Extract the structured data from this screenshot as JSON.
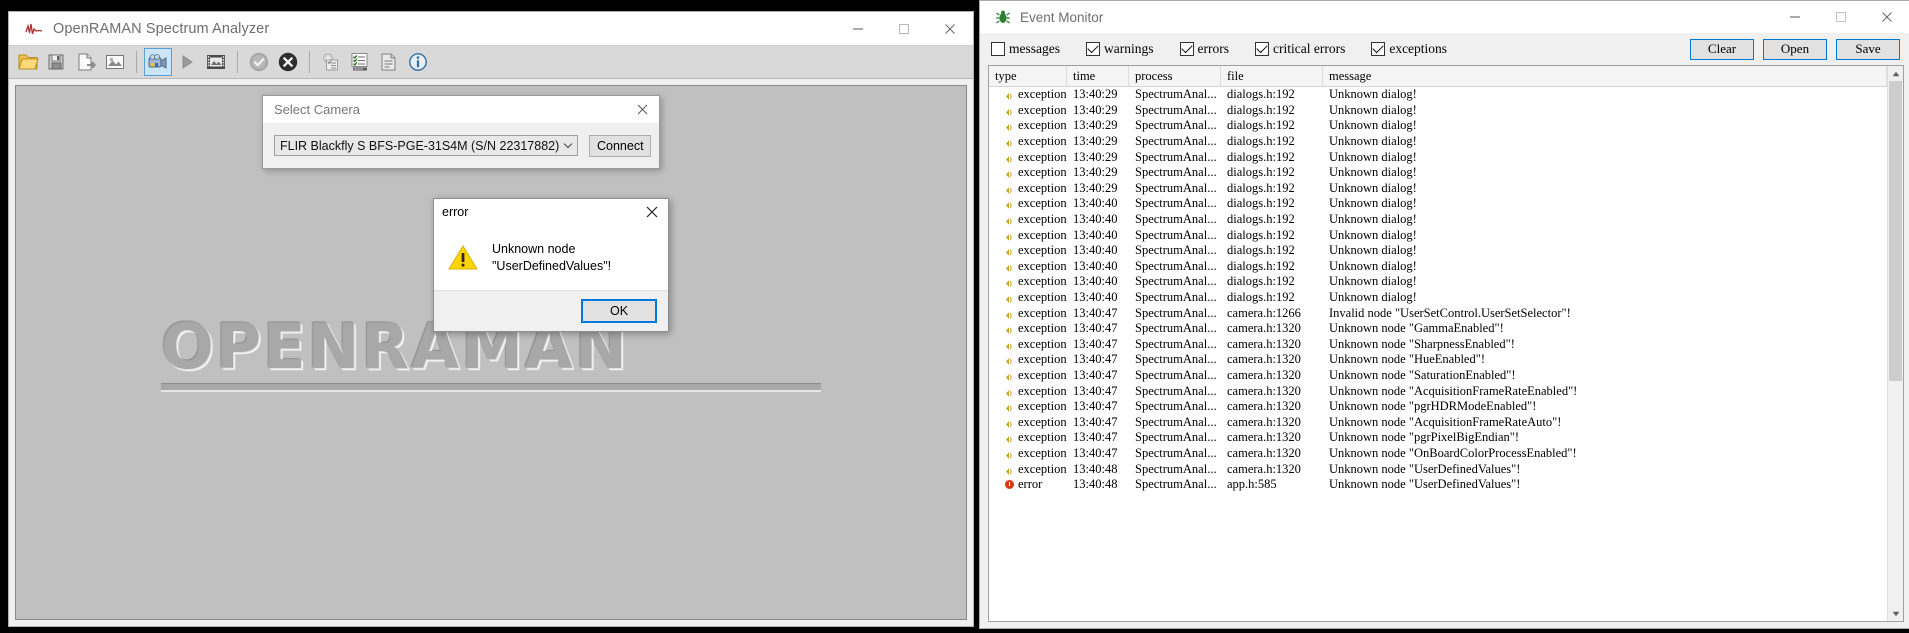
{
  "main_window": {
    "title": "OpenRAMAN Spectrum Analyzer",
    "app_icon": "waveform-icon",
    "controls": {
      "minimize": "minimize-icon",
      "maximize": "maximize-icon",
      "close": "close-icon"
    },
    "toolbar": [
      {
        "name": "open-file-button",
        "icon": "folder-icon",
        "selected": false
      },
      {
        "name": "save-button",
        "icon": "save-disk-icon",
        "selected": false
      },
      {
        "name": "copy-button",
        "icon": "copy-page-icon",
        "selected": false
      },
      {
        "name": "export-image-button",
        "icon": "export-image-icon",
        "selected": false
      },
      {
        "name": "camera-button",
        "icon": "video-camera-icon",
        "selected": true
      },
      {
        "name": "play-button",
        "icon": "play-triangle-icon",
        "selected": false
      },
      {
        "name": "film-button",
        "icon": "film-strip-icon",
        "selected": false
      },
      {
        "name": "accept-button",
        "icon": "check-circle-icon",
        "selected": false
      },
      {
        "name": "cancel-button",
        "icon": "cross-circle-icon",
        "selected": false
      },
      {
        "name": "calibration-button",
        "icon": "clipboard-gear-icon",
        "selected": false
      },
      {
        "name": "checklist-button",
        "icon": "checklist-icon",
        "selected": false
      },
      {
        "name": "properties-button",
        "icon": "properties-icon",
        "selected": false
      },
      {
        "name": "about-button",
        "icon": "info-circle-icon",
        "selected": false
      }
    ],
    "watermark": "OPENRAMAN"
  },
  "select_camera_dialog": {
    "title": "Select Camera",
    "close_icon": "close-icon",
    "camera_value": "FLIR Blackfly S BFS-PGE-31S4M (S/N 22317882)",
    "dropdown_icon": "chevron-down-icon",
    "connect_label": "Connect"
  },
  "error_dialog": {
    "title": "error",
    "close_icon": "close-icon",
    "warning_icon": "warning-triangle-icon",
    "message": "Unknown node \"UserDefinedValues\"!",
    "ok_label": "OK"
  },
  "event_monitor": {
    "title": "Event Monitor",
    "app_icon": "green-bug-icon",
    "controls": {
      "minimize": "minimize-icon",
      "maximize": "maximize-icon",
      "close": "close-icon"
    },
    "filters": [
      {
        "label": "messages",
        "checked": false
      },
      {
        "label": "warnings",
        "checked": true
      },
      {
        "label": "errors",
        "checked": true
      },
      {
        "label": "critical errors",
        "checked": true
      },
      {
        "label": "exceptions",
        "checked": true
      }
    ],
    "actions": [
      {
        "label": "Clear"
      },
      {
        "label": "Open"
      },
      {
        "label": "Save"
      }
    ],
    "columns": [
      "type",
      "time",
      "process",
      "file",
      "message"
    ],
    "rows": [
      {
        "type": "exception",
        "time": "13:40:29",
        "process": "SpectrumAnal...",
        "file": "dialogs.h:192",
        "message": "Unknown dialog!"
      },
      {
        "type": "exception",
        "time": "13:40:29",
        "process": "SpectrumAnal...",
        "file": "dialogs.h:192",
        "message": "Unknown dialog!"
      },
      {
        "type": "exception",
        "time": "13:40:29",
        "process": "SpectrumAnal...",
        "file": "dialogs.h:192",
        "message": "Unknown dialog!"
      },
      {
        "type": "exception",
        "time": "13:40:29",
        "process": "SpectrumAnal...",
        "file": "dialogs.h:192",
        "message": "Unknown dialog!"
      },
      {
        "type": "exception",
        "time": "13:40:29",
        "process": "SpectrumAnal...",
        "file": "dialogs.h:192",
        "message": "Unknown dialog!"
      },
      {
        "type": "exception",
        "time": "13:40:29",
        "process": "SpectrumAnal...",
        "file": "dialogs.h:192",
        "message": "Unknown dialog!"
      },
      {
        "type": "exception",
        "time": "13:40:29",
        "process": "SpectrumAnal...",
        "file": "dialogs.h:192",
        "message": "Unknown dialog!"
      },
      {
        "type": "exception",
        "time": "13:40:40",
        "process": "SpectrumAnal...",
        "file": "dialogs.h:192",
        "message": "Unknown dialog!"
      },
      {
        "type": "exception",
        "time": "13:40:40",
        "process": "SpectrumAnal...",
        "file": "dialogs.h:192",
        "message": "Unknown dialog!"
      },
      {
        "type": "exception",
        "time": "13:40:40",
        "process": "SpectrumAnal...",
        "file": "dialogs.h:192",
        "message": "Unknown dialog!"
      },
      {
        "type": "exception",
        "time": "13:40:40",
        "process": "SpectrumAnal...",
        "file": "dialogs.h:192",
        "message": "Unknown dialog!"
      },
      {
        "type": "exception",
        "time": "13:40:40",
        "process": "SpectrumAnal...",
        "file": "dialogs.h:192",
        "message": "Unknown dialog!"
      },
      {
        "type": "exception",
        "time": "13:40:40",
        "process": "SpectrumAnal...",
        "file": "dialogs.h:192",
        "message": "Unknown dialog!"
      },
      {
        "type": "exception",
        "time": "13:40:40",
        "process": "SpectrumAnal...",
        "file": "dialogs.h:192",
        "message": "Unknown dialog!"
      },
      {
        "type": "exception",
        "time": "13:40:47",
        "process": "SpectrumAnal...",
        "file": "camera.h:1266",
        "message": "Invalid node \"UserSetControl.UserSetSelector\"!"
      },
      {
        "type": "exception",
        "time": "13:40:47",
        "process": "SpectrumAnal...",
        "file": "camera.h:1320",
        "message": "Unknown node \"GammaEnabled\"!"
      },
      {
        "type": "exception",
        "time": "13:40:47",
        "process": "SpectrumAnal...",
        "file": "camera.h:1320",
        "message": "Unknown node \"SharpnessEnabled\"!"
      },
      {
        "type": "exception",
        "time": "13:40:47",
        "process": "SpectrumAnal...",
        "file": "camera.h:1320",
        "message": "Unknown node \"HueEnabled\"!"
      },
      {
        "type": "exception",
        "time": "13:40:47",
        "process": "SpectrumAnal...",
        "file": "camera.h:1320",
        "message": "Unknown node \"SaturationEnabled\"!"
      },
      {
        "type": "exception",
        "time": "13:40:47",
        "process": "SpectrumAnal...",
        "file": "camera.h:1320",
        "message": "Unknown node \"AcquisitionFrameRateEnabled\"!"
      },
      {
        "type": "exception",
        "time": "13:40:47",
        "process": "SpectrumAnal...",
        "file": "camera.h:1320",
        "message": "Unknown node \"pgrHDRModeEnabled\"!"
      },
      {
        "type": "exception",
        "time": "13:40:47",
        "process": "SpectrumAnal...",
        "file": "camera.h:1320",
        "message": "Unknown node \"AcquisitionFrameRateAuto\"!"
      },
      {
        "type": "exception",
        "time": "13:40:47",
        "process": "SpectrumAnal...",
        "file": "camera.h:1320",
        "message": "Unknown node \"pgrPixelBigEndian\"!"
      },
      {
        "type": "exception",
        "time": "13:40:47",
        "process": "SpectrumAnal...",
        "file": "camera.h:1320",
        "message": "Unknown node \"OnBoardColorProcessEnabled\"!"
      },
      {
        "type": "exception",
        "time": "13:40:48",
        "process": "SpectrumAnal...",
        "file": "camera.h:1320",
        "message": "Unknown node \"UserDefinedValues\"!"
      },
      {
        "type": "error",
        "time": "13:40:48",
        "process": "SpectrumAnal...",
        "file": "app.h:585",
        "message": "Unknown node \"UserDefinedValues\"!"
      }
    ]
  }
}
